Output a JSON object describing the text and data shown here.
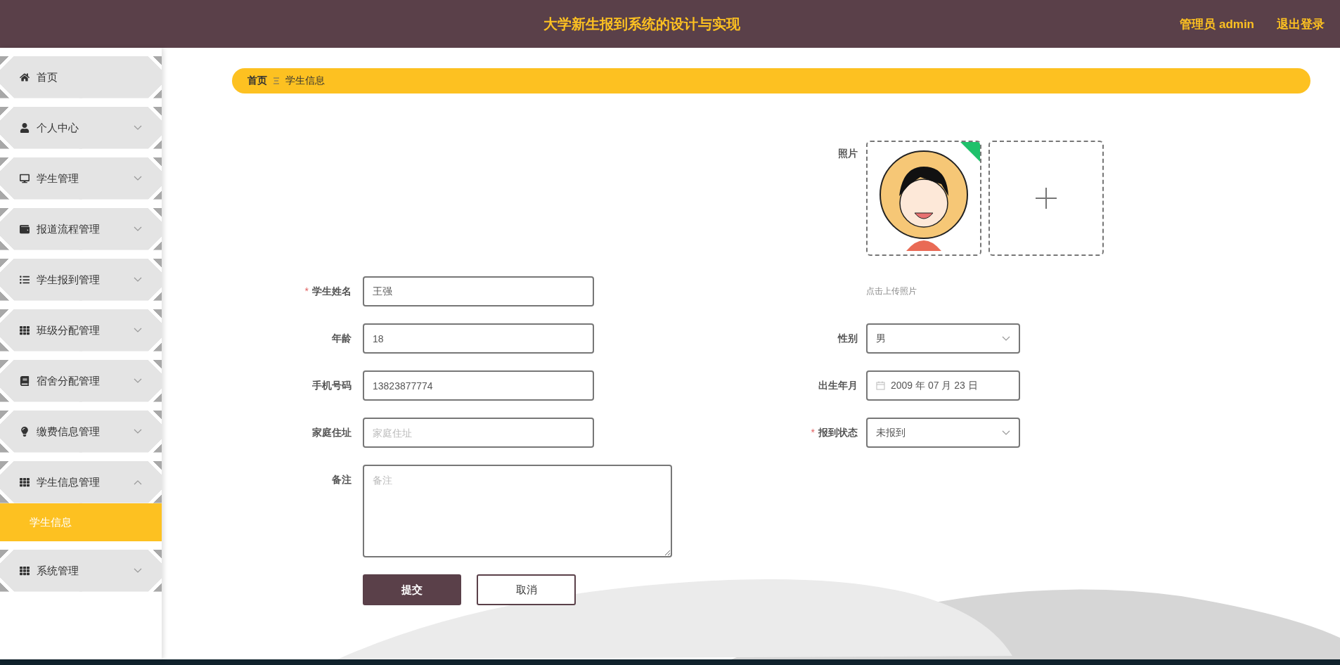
{
  "header": {
    "title": "大学新生报到系统的设计与实现",
    "user": "管理员 admin",
    "logout": "退出登录"
  },
  "sidebar": {
    "items": [
      {
        "label": "首页",
        "kind": "link"
      },
      {
        "label": "个人中心",
        "kind": "menu",
        "expanded": false
      },
      {
        "label": "学生管理",
        "kind": "menu",
        "expanded": false
      },
      {
        "label": "报道流程管理",
        "kind": "menu",
        "expanded": false
      },
      {
        "label": "学生报到管理",
        "kind": "menu",
        "expanded": false
      },
      {
        "label": "班级分配管理",
        "kind": "menu",
        "expanded": false
      },
      {
        "label": "宿舍分配管理",
        "kind": "menu",
        "expanded": false
      },
      {
        "label": "缴费信息管理",
        "kind": "menu",
        "expanded": false
      },
      {
        "label": "学生信息管理",
        "kind": "menu",
        "expanded": true,
        "children": [
          {
            "label": "学生信息",
            "selected": true
          }
        ]
      },
      {
        "label": "系统管理",
        "kind": "menu",
        "expanded": false
      }
    ]
  },
  "breadcrumb": [
    "首页",
    "学生信息"
  ],
  "form": {
    "photo": {
      "label": "照片",
      "uploaded": true,
      "hint": "点击上传照片"
    },
    "left": [
      {
        "kind": "text",
        "label": "学生姓名",
        "required_mark": "*",
        "value": "王强"
      },
      {
        "kind": "text",
        "label": "年龄",
        "value": "18"
      },
      {
        "kind": "text",
        "label": "手机号码",
        "value": "13823877774"
      },
      {
        "kind": "text",
        "label": "家庭住址",
        "placeholder": "家庭住址"
      },
      {
        "kind": "textarea",
        "label": "备注",
        "placeholder": "备注"
      }
    ],
    "right": [
      {
        "kind": "select",
        "label": "性别",
        "value": "男"
      },
      {
        "kind": "date",
        "label": "出生年月",
        "value": "2009 年 07 月 23 日"
      },
      {
        "kind": "select",
        "label": "报到状态",
        "required_mark": "*",
        "value": "未报到"
      }
    ],
    "buttons": [
      {
        "label": "提交",
        "kind": "primary"
      },
      {
        "label": "取消",
        "kind": "default"
      }
    ]
  }
}
